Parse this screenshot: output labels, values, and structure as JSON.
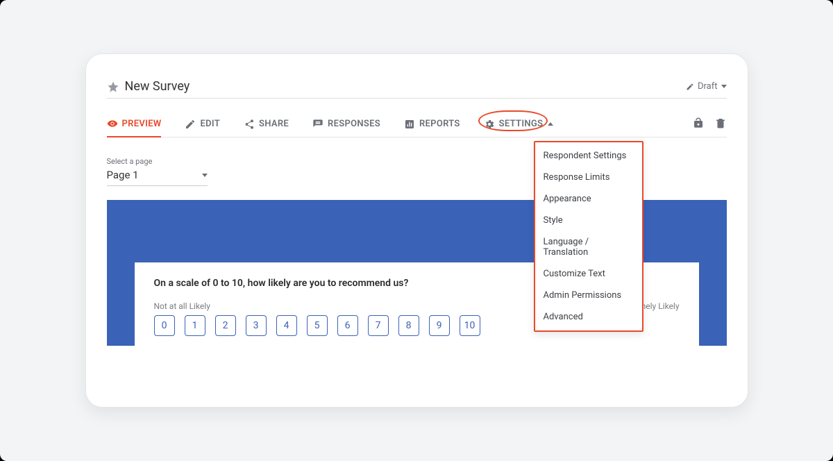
{
  "header": {
    "survey_title": "New Survey",
    "status_label": "Draft"
  },
  "tabs": {
    "preview": "PREVIEW",
    "edit": "EDIT",
    "share": "SHARE",
    "responses": "RESPONSES",
    "reports": "REPORTS",
    "settings": "SETTINGS"
  },
  "settings_menu": {
    "items": [
      "Respondent Settings",
      "Response Limits",
      "Appearance",
      "Style",
      "Language / Translation",
      "Customize Text",
      "Admin Permissions",
      "Advanced"
    ]
  },
  "page_selector": {
    "label": "Select a page",
    "value": "Page 1"
  },
  "question": {
    "text": "On a scale of 0 to 10, how likely are you to recommend us?",
    "low_label": "Not at all Likely",
    "high_label": "Extremely Likely",
    "options": [
      "0",
      "1",
      "2",
      "3",
      "4",
      "5",
      "6",
      "7",
      "8",
      "9",
      "10"
    ]
  }
}
